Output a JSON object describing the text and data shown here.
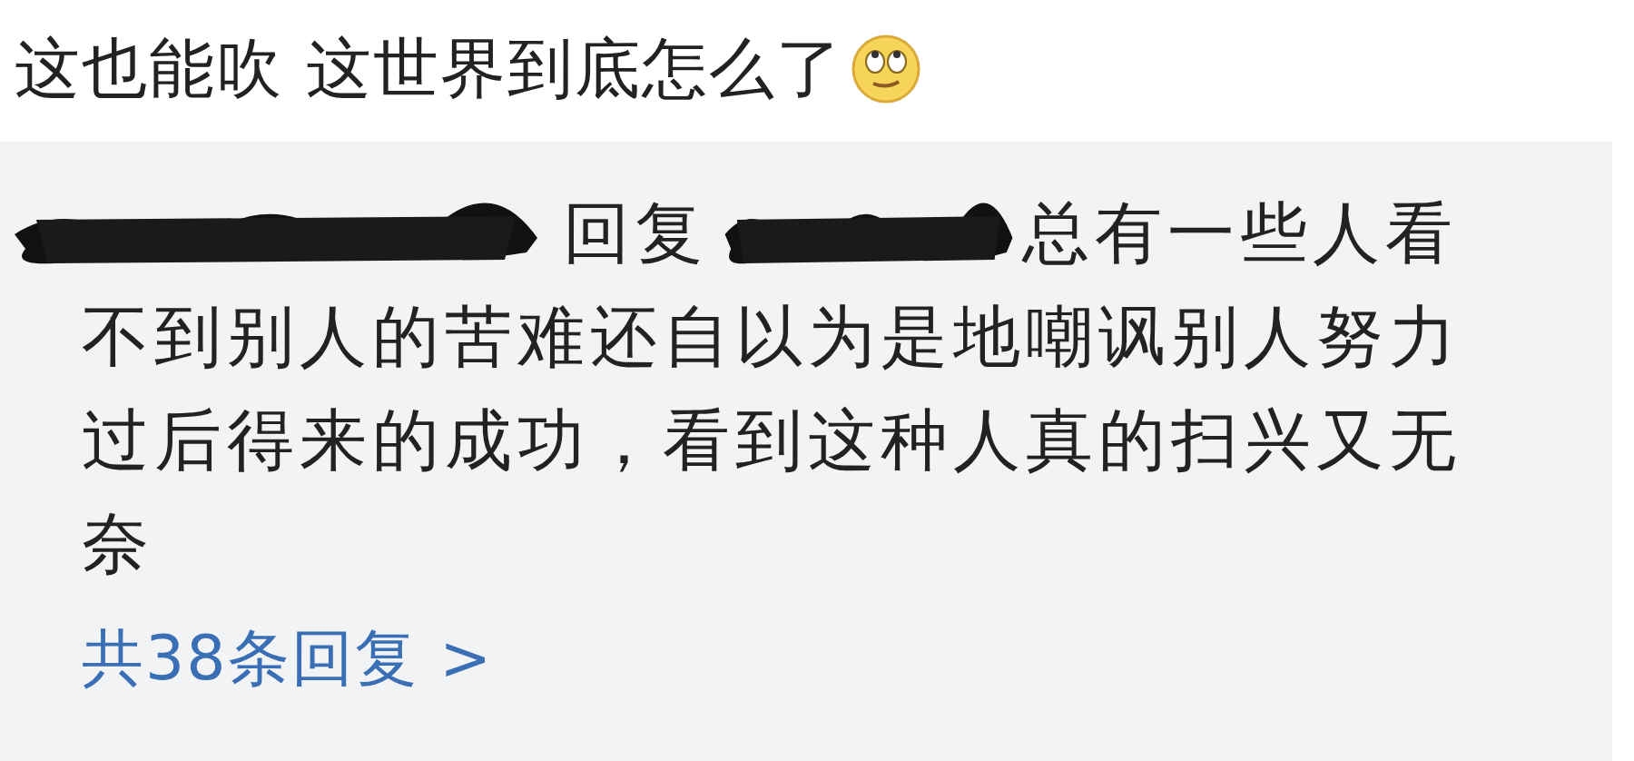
{
  "post": {
    "title": "这也能吹 这世界到底怎么了"
  },
  "reply_box": {
    "segments": [
      {
        "kind": "redacted"
      },
      {
        "kind": "text",
        "text": "回复"
      },
      {
        "kind": "redacted"
      },
      {
        "kind": "text",
        "text": "总有一些人看"
      },
      {
        "kind": "paragraph",
        "text": "不到别人的苦难还自以为是地嘲讽别人努力过后得来的成功，看到这种人真的扫兴又无奈"
      }
    ],
    "more_link": "共38条回复 >"
  }
}
